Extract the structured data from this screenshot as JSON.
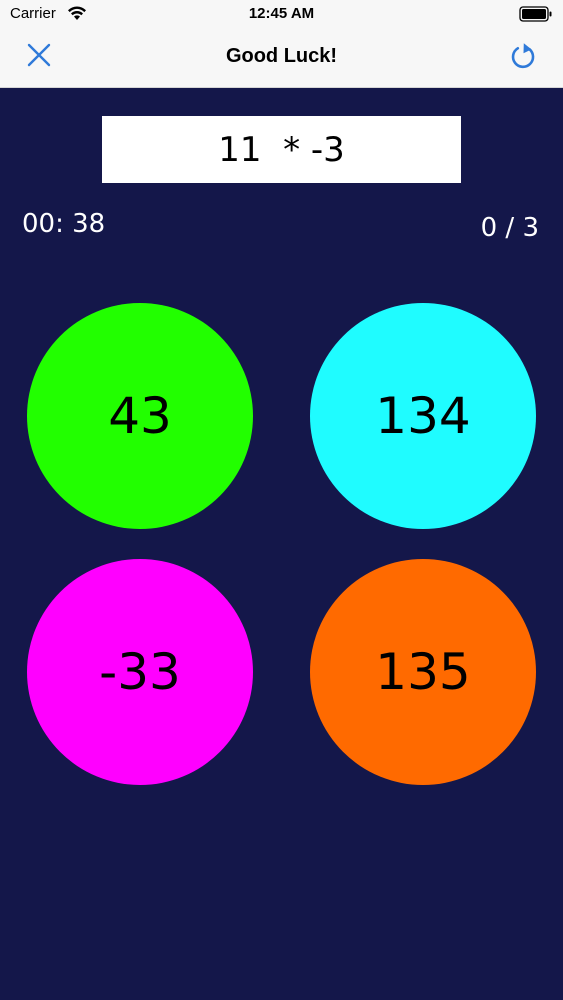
{
  "status_bar": {
    "carrier": "Carrier",
    "time": "12:45 AM",
    "wifi_icon": "wifi-icon",
    "battery_icon": "battery-icon"
  },
  "nav": {
    "title": "Good Luck!",
    "close_icon": "close-icon",
    "refresh_icon": "refresh-icon",
    "accent_color": "#2f7ad9"
  },
  "question": "11  * -3",
  "timer": "00: 38",
  "score": "0 / 3",
  "answers": [
    {
      "value": "43",
      "color": "#22ff00"
    },
    {
      "value": "134",
      "color": "#1ffcff"
    },
    {
      "value": "-33",
      "color": "#ff00ff"
    },
    {
      "value": "135",
      "color": "#ff6a00"
    }
  ],
  "colors": {
    "background": "#14174a",
    "bar": "#f7f7f7"
  }
}
